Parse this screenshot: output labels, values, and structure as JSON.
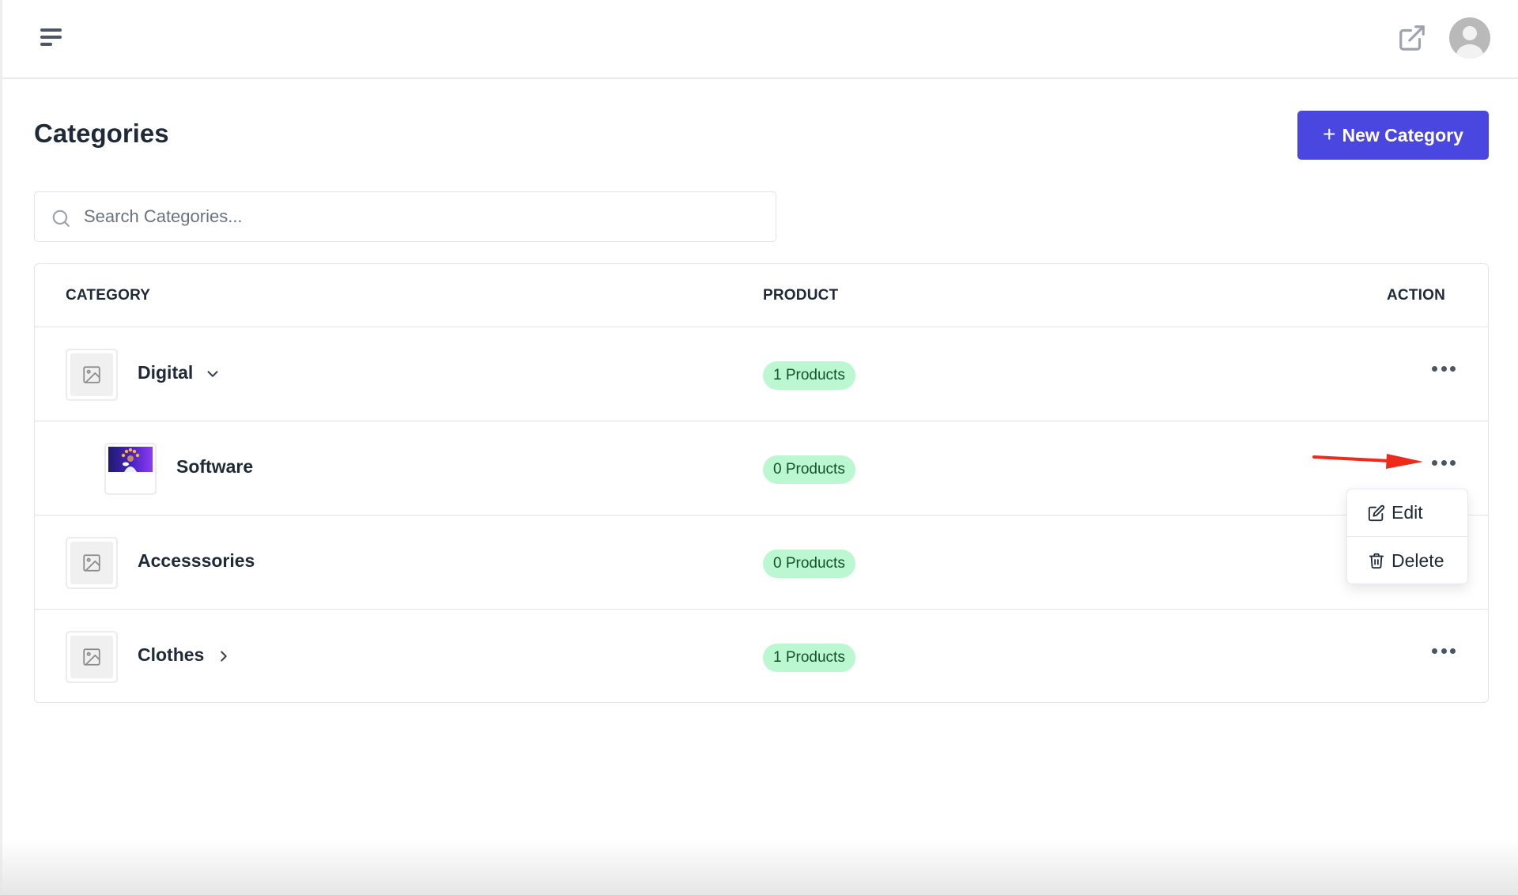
{
  "topbar": {
    "menu_icon": "hamburger-menu-icon",
    "external_icon": "external-link-icon",
    "avatar_icon": "user-avatar-icon"
  },
  "header": {
    "title": "Categories",
    "new_button": {
      "icon": "plus-icon",
      "label": "New Category",
      "color": "#4a46e0"
    }
  },
  "search": {
    "icon": "search-icon",
    "placeholder": "Search Categories...",
    "value": ""
  },
  "table": {
    "columns": [
      "CATEGORY",
      "PRODUCT",
      "ACTION"
    ],
    "rows": [
      {
        "name": "Digital",
        "level": 0,
        "thumbnail": "image-placeholder-icon",
        "toggle": "chevron-down-icon",
        "products": "1 Products"
      },
      {
        "name": "Software",
        "level": 1,
        "thumbnail": "category-photo",
        "toggle": null,
        "products": "0 Products"
      },
      {
        "name": "Accesssories",
        "level": 0,
        "thumbnail": "image-placeholder-icon",
        "toggle": null,
        "products": "0 Products"
      },
      {
        "name": "Clothes",
        "level": 0,
        "thumbnail": "image-placeholder-icon",
        "toggle": "chevron-right-icon",
        "products": "1 Products"
      }
    ],
    "badge_colors": {
      "background": "#bbf7d0",
      "text": "#14532d"
    }
  },
  "action_menu": {
    "open_for_row": "Software",
    "items": [
      {
        "label": "Edit",
        "icon": "edit-icon"
      },
      {
        "label": "Delete",
        "icon": "trash-icon"
      }
    ]
  },
  "annotation": {
    "type": "red-arrow",
    "color": "#f02a1a",
    "points_to": "Software row action button"
  }
}
